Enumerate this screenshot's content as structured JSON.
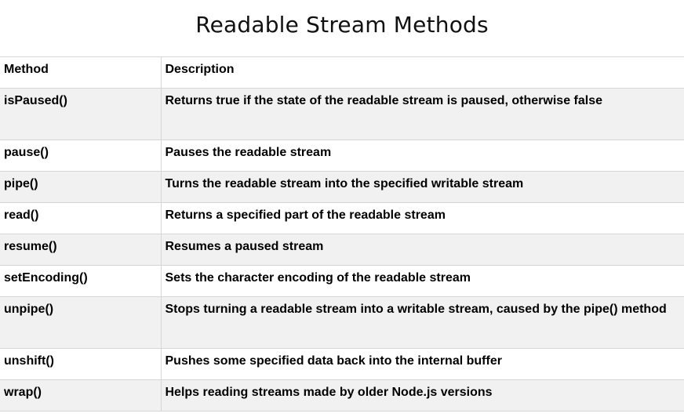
{
  "title": "Readable Stream Methods",
  "table": {
    "headers": [
      "Method",
      "Description"
    ],
    "rows": [
      {
        "method": "isPaused()",
        "description": "Returns true if the state of  the readable stream is paused, otherwise false"
      },
      {
        "method": "pause()",
        "description": "Pauses the readable stream"
      },
      {
        "method": "pipe()",
        "description": "Turns the readable stream into the specified writable stream"
      },
      {
        "method": "read()",
        "description": "Returns a specified part of the readable stream"
      },
      {
        "method": "resume()",
        "description": "Resumes a paused stream"
      },
      {
        "method": "setEncoding()",
        "description": "Sets the character encoding of the readable stream"
      },
      {
        "method": "unpipe()",
        "description": "Stops turning a readable stream into a writable stream, caused by the pipe() method"
      },
      {
        "method": "unshift()",
        "description": "Pushes some specified data back into the internal buffer"
      },
      {
        "method": "wrap()",
        "description": "Helps reading streams made by older Node.js versions"
      }
    ]
  }
}
